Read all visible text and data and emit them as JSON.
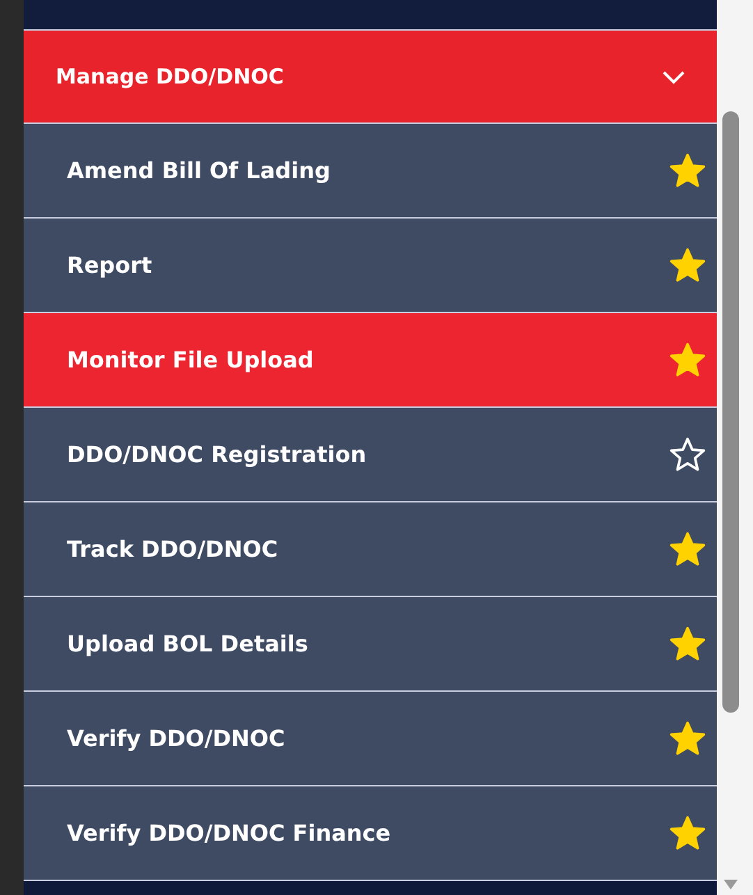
{
  "menu": {
    "title": "Manage DDO/DNOC",
    "expanded": true,
    "items": [
      {
        "label": "Amend Bill Of Lading",
        "selected": false,
        "favorite": true
      },
      {
        "label": "Report",
        "selected": false,
        "favorite": true
      },
      {
        "label": "Monitor File Upload",
        "selected": true,
        "favorite": true
      },
      {
        "label": "DDO/DNOC Registration",
        "selected": false,
        "favorite": false
      },
      {
        "label": "Track DDO/DNOC",
        "selected": false,
        "favorite": true
      },
      {
        "label": "Upload BOL Details",
        "selected": false,
        "favorite": true
      },
      {
        "label": "Verify DDO/DNOC",
        "selected": false,
        "favorite": true
      },
      {
        "label": "Verify DDO/DNOC Finance",
        "selected": false,
        "favorite": true
      }
    ]
  }
}
